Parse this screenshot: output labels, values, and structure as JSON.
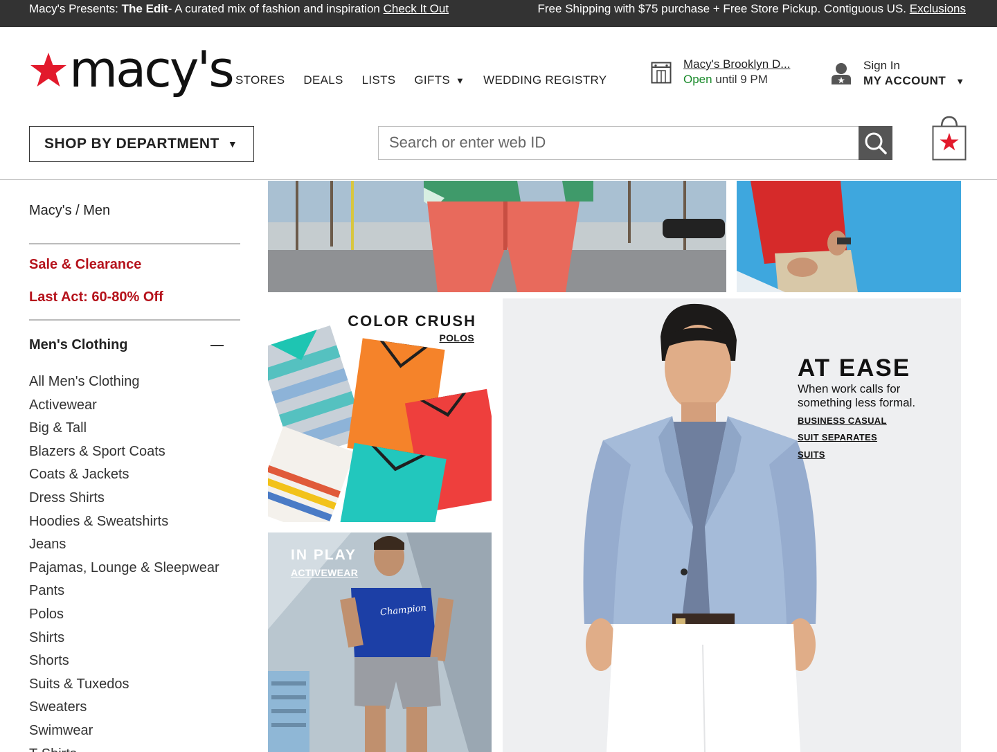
{
  "promo": {
    "left_prefix": "Macy's Presents: ",
    "left_bold": "The Edit",
    "left_text": "- A curated mix of fashion and inspiration ",
    "left_link": "Check It Out",
    "right_text": "Free Shipping with $75 purchase + Free Store Pickup. Contiguous US. ",
    "right_link": "Exclusions"
  },
  "logo": {
    "text": "macy's"
  },
  "nav": {
    "stores": "STORES",
    "deals": "DEALS",
    "lists": "LISTS",
    "gifts": "GIFTS",
    "wedding": "WEDDING REGISTRY"
  },
  "store": {
    "name": "Macy's Brooklyn D...",
    "open": "Open",
    "hours": " until 9 PM"
  },
  "account": {
    "sign_in": "Sign In",
    "my_account": "MY ACCOUNT"
  },
  "department": {
    "label": "SHOP BY DEPARTMENT"
  },
  "search": {
    "placeholder": "Search or enter web ID",
    "value": ""
  },
  "sidebar": {
    "breadcrumb": "Macy's / Men",
    "sale": "Sale & Clearance",
    "last_act": "Last Act: 60-80% Off",
    "section_title": "Men's Clothing",
    "items": [
      "All Men's Clothing",
      "Activewear",
      "Big & Tall",
      "Blazers & Sport Coats",
      "Coats & Jackets",
      "Dress Shirts",
      "Hoodies & Sweatshirts",
      "Jeans",
      "Pajamas, Lounge & Sleepwear",
      "Pants",
      "Polos",
      "Shirts",
      "Shorts",
      "Suits & Tuxedos",
      "Sweaters",
      "Swimwear",
      "T-Shirts"
    ]
  },
  "tiles": {
    "color_crush": {
      "title": "COLOR CRUSH",
      "link": "POLOS"
    },
    "in_play": {
      "title": "IN PLAY",
      "link": "ACTIVEWEAR"
    },
    "at_ease": {
      "title": "AT EASE",
      "subtitle_1": "When work calls for",
      "subtitle_2": "something less formal.",
      "links": [
        "BUSINESS CASUAL",
        "SUIT SEPARATES",
        "SUITS"
      ]
    },
    "shirt_logo": "Champion"
  },
  "colors": {
    "promo_bg": "#333333",
    "brand_red": "#e21a2c",
    "sale_red": "#b5121b",
    "open_green": "#1a8a2b",
    "search_button": "#555555"
  },
  "icons": {
    "logo_star": "star-icon",
    "store": "store-icon",
    "account": "user-icon",
    "search": "search-icon",
    "bag": "shopping-bag-icon",
    "collapse": "minus-icon",
    "dropdown": "caret-down-icon"
  }
}
